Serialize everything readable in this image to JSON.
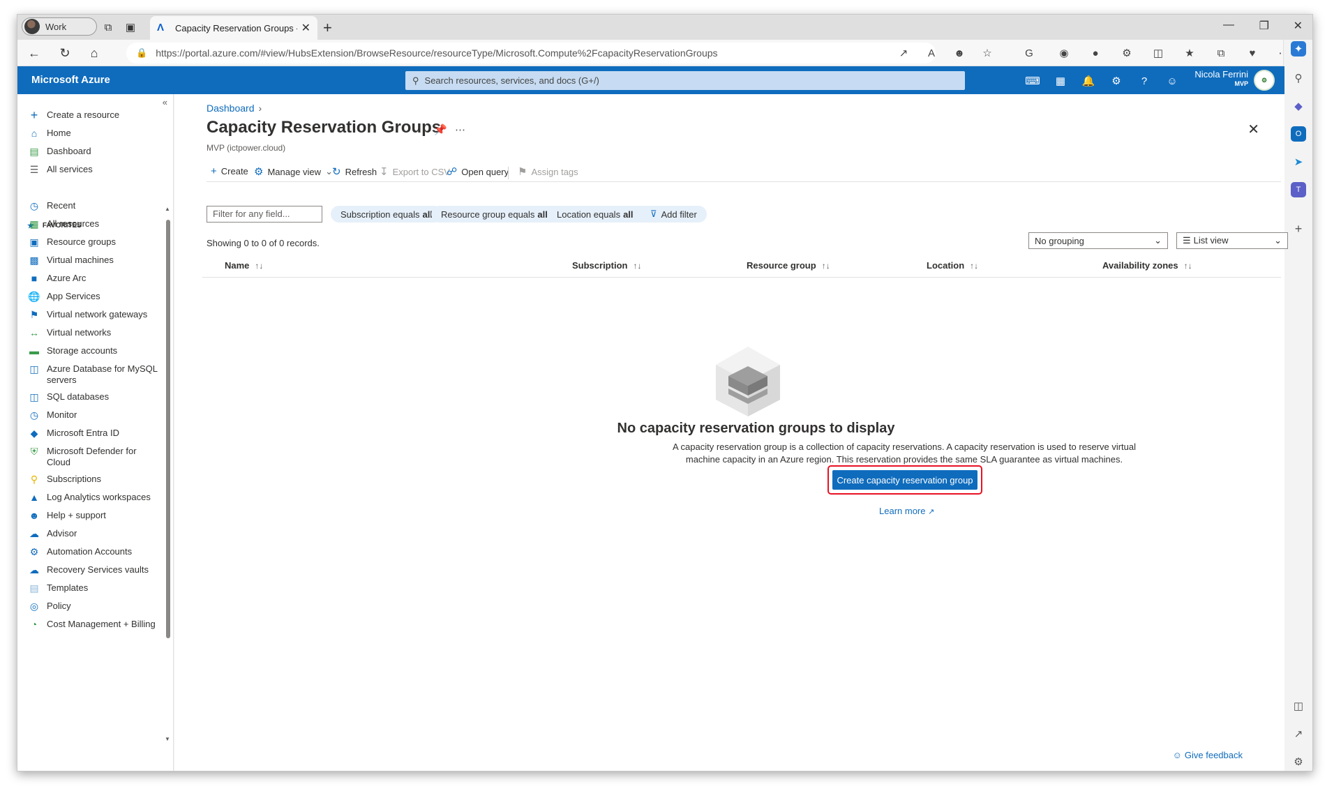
{
  "browser": {
    "profile_label": "Work",
    "tab_title": "Capacity Reservation Groups - M",
    "url": "https://portal.azure.com/#view/HubsExtension/BrowseResource/resourceType/Microsoft.Compute%2FcapacityReservationGroups"
  },
  "header": {
    "brand": "Microsoft Azure",
    "search_placeholder": "Search resources, services, and docs (G+/)",
    "user_name": "Nicola Ferrini",
    "user_role": "MVP"
  },
  "sidebar": {
    "favorites_label": "FAVORITES",
    "top_items": [
      {
        "label": "Create a resource"
      },
      {
        "label": "Home"
      },
      {
        "label": "Dashboard"
      },
      {
        "label": "All services"
      }
    ],
    "items": [
      {
        "label": "Recent"
      },
      {
        "label": "All resources"
      },
      {
        "label": "Resource groups"
      },
      {
        "label": "Virtual machines"
      },
      {
        "label": "Azure Arc"
      },
      {
        "label": "App Services"
      },
      {
        "label": "Virtual network gateways"
      },
      {
        "label": "Virtual networks"
      },
      {
        "label": "Storage accounts"
      },
      {
        "label": "Azure Database for MySQL servers"
      },
      {
        "label": "SQL databases"
      },
      {
        "label": "Monitor"
      },
      {
        "label": "Microsoft Entra ID"
      },
      {
        "label": "Microsoft Defender for Cloud"
      },
      {
        "label": "Subscriptions"
      },
      {
        "label": "Log Analytics workspaces"
      },
      {
        "label": "Help + support"
      },
      {
        "label": "Advisor"
      },
      {
        "label": "Automation Accounts"
      },
      {
        "label": "Recovery Services vaults"
      },
      {
        "label": "Templates"
      },
      {
        "label": "Policy"
      },
      {
        "label": "Cost Management + Billing"
      }
    ]
  },
  "main": {
    "breadcrumb": "Dashboard",
    "title": "Capacity Reservation Groups",
    "subtitle": "MVP (ictpower.cloud)",
    "commands": {
      "create": "Create",
      "manage_view": "Manage view",
      "refresh": "Refresh",
      "export_csv": "Export to CSV",
      "open_query": "Open query",
      "assign_tags": "Assign tags"
    },
    "filter_placeholder": "Filter for any field...",
    "filters": {
      "subscription": {
        "label": "Subscription equals",
        "value": "all"
      },
      "resource_group": {
        "label": "Resource group equals",
        "value": "all"
      },
      "location": {
        "label": "Location equals",
        "value": "all"
      },
      "add": "Add filter"
    },
    "records_text": "Showing 0 to 0 of 0 records.",
    "grouping_value": "No grouping",
    "view_value": "List view",
    "columns": [
      "Name",
      "Subscription",
      "Resource group",
      "Location",
      "Availability zones"
    ],
    "empty": {
      "title": "No capacity reservation groups to display",
      "description": "A capacity reservation group is a collection of capacity reservations. A capacity reservation is used to reserve virtual machine capacity in an Azure region. This reservation provides the same SLA guarantee as virtual machines.",
      "button": "Create capacity reservation group",
      "learn_more": "Learn more"
    },
    "feedback": "Give feedback"
  }
}
